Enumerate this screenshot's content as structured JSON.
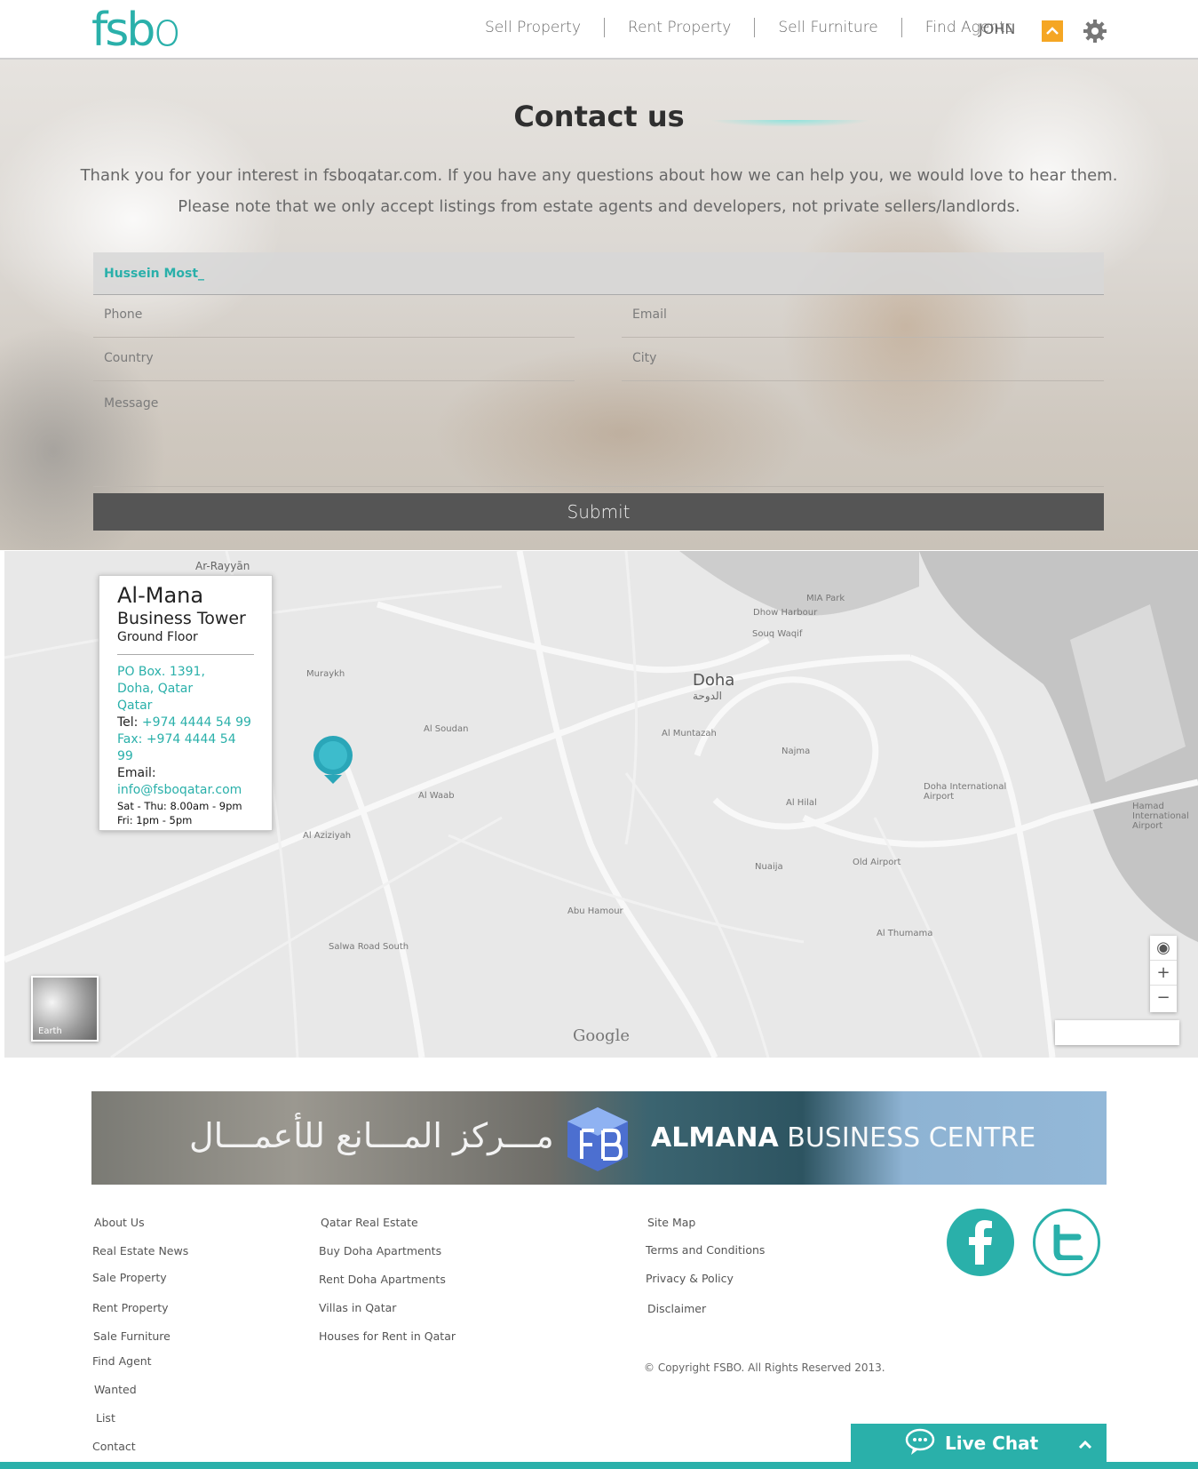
{
  "brand": {
    "logo_text": "fsb",
    "logo_o": "o",
    "accent": "#2ab0aa",
    "orange": "#f5a623"
  },
  "nav": {
    "items": [
      "Sell Property",
      "Rent Property",
      "Sell Furniture",
      "Find Agents"
    ],
    "user": "JOHN"
  },
  "hero": {
    "title": "Contact us",
    "line1": "Thank you for your interest in fsboqatar.com. If you have any questions about how we can help you, we would love to hear them.",
    "line2": "Please note that we only accept listings from estate agents and developers, not private sellers/landlords."
  },
  "form": {
    "name_value": "Hussein Most_",
    "phone_placeholder": "Phone",
    "email_placeholder": "Email",
    "country_placeholder": "Country",
    "city_placeholder": "City",
    "message_placeholder": "Message",
    "submit_label": "Submit"
  },
  "map": {
    "card": {
      "title": "Al-Mana",
      "subtitle": "Business Tower",
      "floor": "Ground Floor",
      "addr1": "PO Box. 1391,",
      "addr2": "Doha, Qatar",
      "addr3": "Qatar",
      "tel_label": "Tel:",
      "tel": "+974 4444 54 99",
      "fax_label": "Fax:",
      "fax": "+974 4444 54 99",
      "email_label": "Email:",
      "email": "info@fsboqatar.com",
      "hours1": "Sat - Thu: 8.00am - 9pm",
      "hours2": "Fri: 1pm - 5pm"
    },
    "labels": {
      "ar_rayyan": "Ar-Rayyān",
      "doha": "Doha",
      "doha_ar": "الدوحة",
      "souq": "Souq Waqif",
      "dhow": "Dhow Harbour",
      "mia": "MIA Park",
      "murraykh": "Muraykh",
      "al_soudan": "Al Soudan",
      "al_muntazah": "Al Muntazah",
      "najma": "Najma",
      "al_hilal": "Al Hilal",
      "old_airport": "Old Airport",
      "airport": "Doha International Airport",
      "hamad": "Hamad International Airport",
      "al_waab": "Al Waab",
      "al_aziziyah": "Al Aziziyah",
      "abu_hamour": "Abu Hamour",
      "salwa": "Salwa Road South",
      "al_thumama": "Al Thumama",
      "nuaija": "Nuaija",
      "earth": "Earth",
      "google": "Google"
    }
  },
  "banner": {
    "arabic": "مـــركز المـــانع للأعمـــال",
    "en_bold": "ALMANA",
    "en_light": " BUSINESS ",
    "en_centre": "CENTRE"
  },
  "footer": {
    "col1": [
      "About Us",
      "Real Estate News",
      "Sale Property",
      "Rent Property",
      "Sale Furniture",
      "Find Agent",
      "Wanted",
      "List",
      "Contact"
    ],
    "col2": [
      "Qatar Real Estate",
      "Buy Doha Apartments",
      "Rent Doha Apartments",
      "Villas in Qatar",
      "Houses for Rent in Qatar"
    ],
    "col3": [
      "Site Map",
      "Terms and Conditions",
      "Privacy & Policy",
      "Disclaimer"
    ],
    "copyright": "© Copyright FSBO. All Rights Reserved 2013.",
    "livechat": "Live Chat"
  }
}
